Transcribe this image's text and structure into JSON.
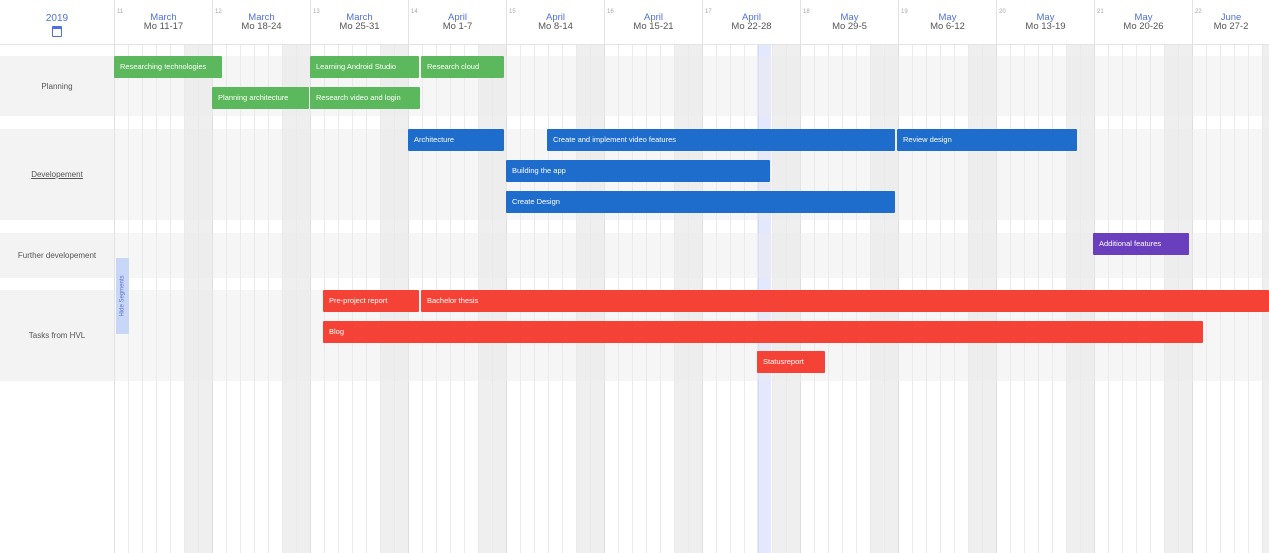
{
  "header": {
    "year": "2019",
    "weeks": [
      {
        "num": "11",
        "month": "March",
        "range": "Mo 11-17"
      },
      {
        "num": "12",
        "month": "March",
        "range": "Mo 18-24"
      },
      {
        "num": "13",
        "month": "March",
        "range": "Mo 25-31"
      },
      {
        "num": "14",
        "month": "April",
        "range": "Mo 1-7"
      },
      {
        "num": "15",
        "month": "April",
        "range": "Mo 8-14"
      },
      {
        "num": "16",
        "month": "April",
        "range": "Mo 15-21"
      },
      {
        "num": "17",
        "month": "April",
        "range": "Mo 22-28"
      },
      {
        "num": "18",
        "month": "May",
        "range": "Mo 29-5"
      },
      {
        "num": "19",
        "month": "May",
        "range": "Mo 6-12"
      },
      {
        "num": "20",
        "month": "May",
        "range": "Mo 13-19"
      },
      {
        "num": "21",
        "month": "May",
        "range": "Mo 20-26"
      },
      {
        "num": "22",
        "month": "June",
        "range": "Mo 27-2"
      }
    ]
  },
  "lanes": [
    {
      "label": "Planning"
    },
    {
      "label": "Developement"
    },
    {
      "label": "Further developement"
    },
    {
      "label": "Tasks from HVL"
    }
  ],
  "tasks": [
    {
      "name": "Researching technologies"
    },
    {
      "name": "Learning Android Studio"
    },
    {
      "name": "Research cloud"
    },
    {
      "name": "Planning architecture"
    },
    {
      "name": "Research video and login"
    },
    {
      "name": "Architecture"
    },
    {
      "name": "Create and implement video features"
    },
    {
      "name": "Review design"
    },
    {
      "name": "Building the app"
    },
    {
      "name": "Create Design"
    },
    {
      "name": "Additional features"
    },
    {
      "name": "Pre-project report"
    },
    {
      "name": "Bachelor thesis"
    },
    {
      "name": "Blog"
    },
    {
      "name": "Statusreport"
    }
  ],
  "controls": {
    "hide_segments": "Hide Segments"
  },
  "colors": {
    "planning": "#5cb85c",
    "development": "#1e6ccc",
    "further": "#6a3fbd",
    "hvl": "#f44336",
    "accent": "#4f6fe0"
  }
}
